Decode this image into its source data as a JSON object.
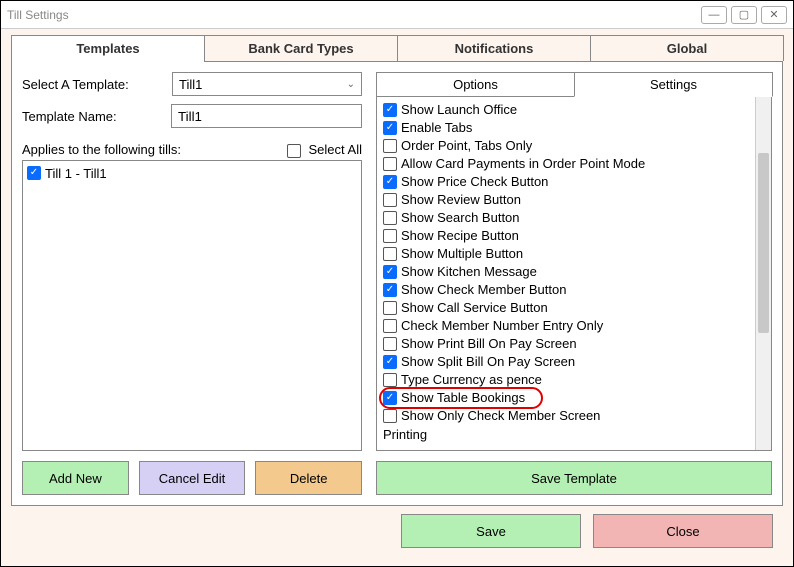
{
  "window": {
    "title": "Till Settings"
  },
  "mainTabs": {
    "templates": "Templates",
    "bankCardTypes": "Bank Card Types",
    "notifications": "Notifications",
    "global": "Global"
  },
  "left": {
    "selectTemplateLabel": "Select A Template:",
    "selectedTemplate": "Till1",
    "templateNameLabel": "Template Name:",
    "templateNameValue": "Till1",
    "appliesLabel": "Applies to the following tills:",
    "selectAllLabel": "Select All",
    "tills": [
      {
        "label": "Till 1 - Till1",
        "checked": true
      }
    ]
  },
  "subTabs": {
    "options": "Options",
    "settings": "Settings"
  },
  "settings": [
    {
      "label": "Show Launch Office",
      "checked": true
    },
    {
      "label": "Enable Tabs",
      "checked": true
    },
    {
      "label": "Order Point, Tabs Only",
      "checked": false
    },
    {
      "label": "Allow Card Payments in Order Point Mode",
      "checked": false
    },
    {
      "label": "Show Price Check Button",
      "checked": true
    },
    {
      "label": "Show Review Button",
      "checked": false
    },
    {
      "label": "Show Search Button",
      "checked": false
    },
    {
      "label": "Show Recipe Button",
      "checked": false
    },
    {
      "label": "Show Multiple Button",
      "checked": false
    },
    {
      "label": "Show Kitchen Message",
      "checked": true
    },
    {
      "label": "Show Check Member Button",
      "checked": true
    },
    {
      "label": "Show Call Service Button",
      "checked": false
    },
    {
      "label": "Check Member Number Entry Only",
      "checked": false
    },
    {
      "label": "Show Print Bill On Pay Screen",
      "checked": false
    },
    {
      "label": "Show Split Bill On Pay Screen",
      "checked": true
    },
    {
      "label": "Type Currency as pence",
      "checked": false
    },
    {
      "label": "Show Table Bookings",
      "checked": true,
      "highlight": true
    },
    {
      "label": "Show Only Check Member Screen",
      "checked": false
    }
  ],
  "sectionLabel": "Printing",
  "buttons": {
    "addNew": "Add New",
    "cancelEdit": "Cancel Edit",
    "delete": "Delete",
    "saveTemplate": "Save Template",
    "save": "Save",
    "close": "Close"
  }
}
